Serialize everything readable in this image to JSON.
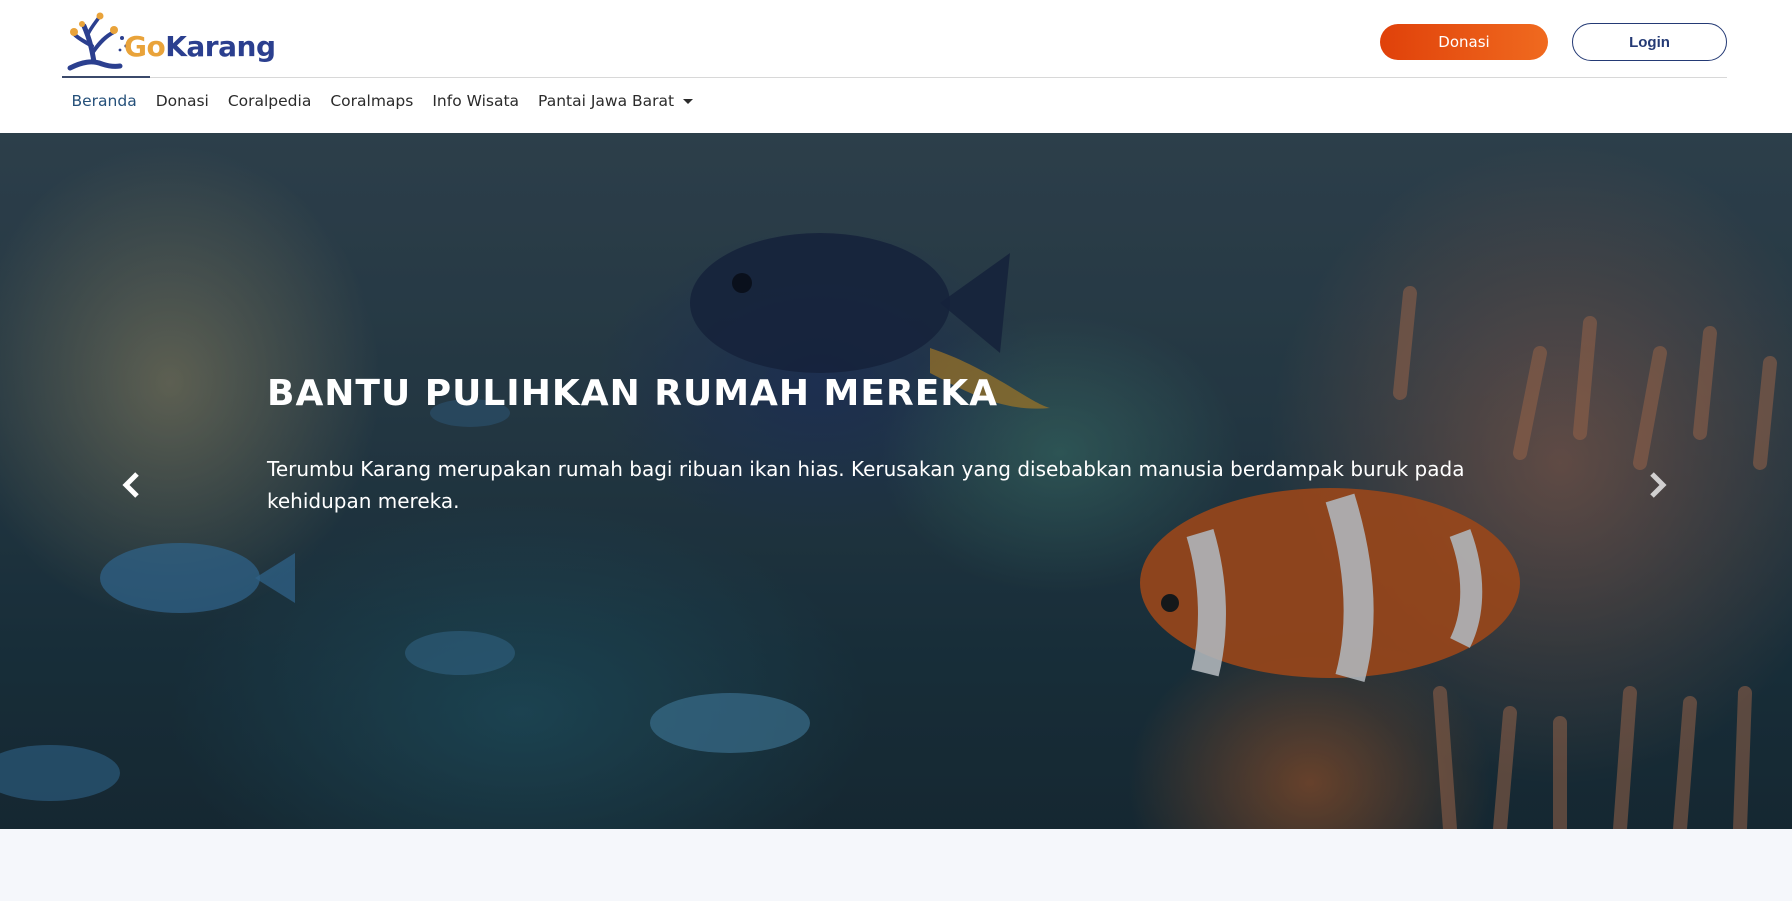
{
  "header": {
    "logo": {
      "icon": "coral-logo-icon",
      "text_go": "Go",
      "text_karang": "Karang"
    },
    "donate_button": "Donasi",
    "login_button": "Login"
  },
  "nav": {
    "items": [
      {
        "label": "Beranda",
        "active": true
      },
      {
        "label": "Donasi"
      },
      {
        "label": "Coralpedia"
      },
      {
        "label": "Coralmaps"
      },
      {
        "label": "Info Wisata"
      },
      {
        "label": "Pantai Jawa Barat",
        "dropdown": true
      }
    ]
  },
  "hero": {
    "title": "BANTU PULIHKAN RUMAH MEREKA",
    "text": "Terumbu Karang merupakan rumah bagi ribuan ikan hias. Kerusakan yang disebabkan manusia berdampak buruk pada kehidupan mereka.",
    "prev_icon": "chevron-left-icon",
    "next_icon": "chevron-right-icon"
  },
  "colors": {
    "brand_orange": "#e9a33a",
    "brand_navy": "#2b3f8f",
    "donate_orange": "#e0410a",
    "login_border": "#243a75"
  }
}
